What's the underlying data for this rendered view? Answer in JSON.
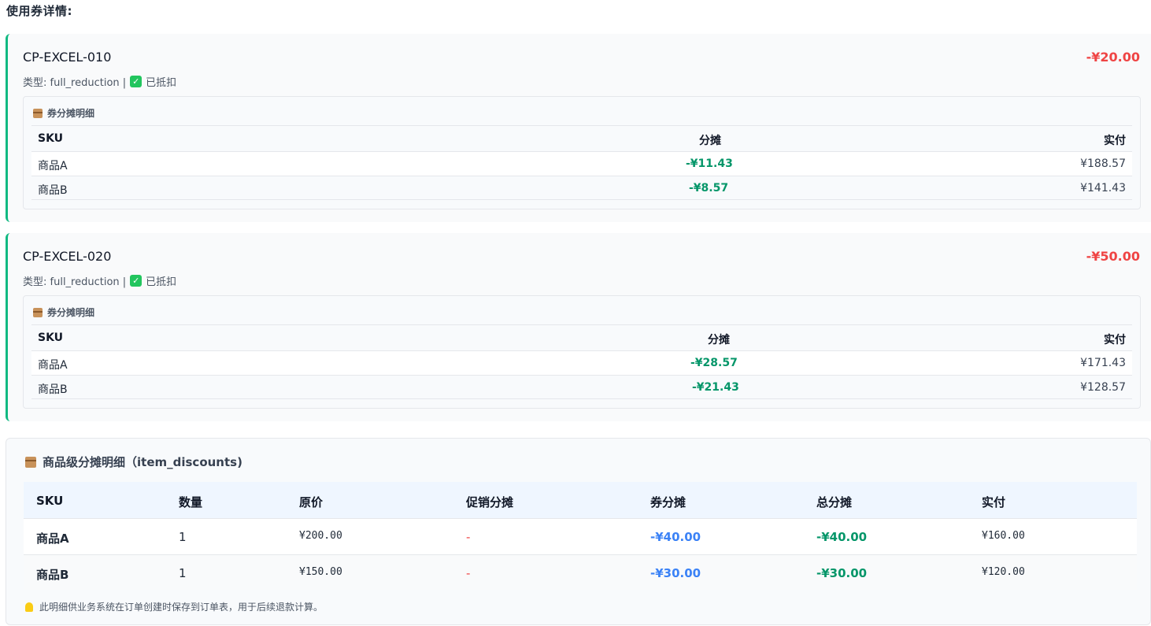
{
  "page_title": "使用券详情:",
  "coupons": [
    {
      "code": "CP-EXCEL-010",
      "amount": "-¥20.00",
      "meta_prefix": "类型: full_reduction |",
      "status": "已抵扣",
      "alloc_title": "券分摊明细",
      "headers": {
        "sku": "SKU",
        "alloc": "分摊",
        "paid": "实付"
      },
      "rows": [
        {
          "sku": "商品A",
          "alloc": "-¥11.43",
          "paid": "¥188.57"
        },
        {
          "sku": "商品B",
          "alloc": "-¥8.57",
          "paid": "¥141.43"
        }
      ]
    },
    {
      "code": "CP-EXCEL-020",
      "amount": "-¥50.00",
      "meta_prefix": "类型: full_reduction |",
      "status": "已抵扣",
      "alloc_title": "券分摊明细",
      "headers": {
        "sku": "SKU",
        "alloc": "分摊",
        "paid": "实付"
      },
      "rows": [
        {
          "sku": "商品A",
          "alloc": "-¥28.57",
          "paid": "¥171.43"
        },
        {
          "sku": "商品B",
          "alloc": "-¥21.43",
          "paid": "¥128.57"
        }
      ]
    }
  ],
  "items_section": {
    "title": "商品级分摊明细（item_discounts)",
    "headers": {
      "sku": "SKU",
      "qty": "数量",
      "orig": "原价",
      "promo": "促销分摊",
      "coupon": "券分摊",
      "total": "总分摊",
      "paid": "实付"
    },
    "rows": [
      {
        "sku": "商品A",
        "qty": "1",
        "orig": "¥200.00",
        "promo": "-",
        "coupon": "-¥40.00",
        "total": "-¥40.00",
        "paid": "¥160.00"
      },
      {
        "sku": "商品B",
        "qty": "1",
        "orig": "¥150.00",
        "promo": "-",
        "coupon": "-¥30.00",
        "total": "-¥30.00",
        "paid": "¥120.00"
      }
    ],
    "note": "此明细供业务系统在订单创建时保存到订单表，用于后续退款计算。"
  },
  "colors": {
    "accent_green": "#10b981",
    "amount_red": "#ef4444",
    "coupon_blue": "#3b82f6",
    "alloc_green": "#059669"
  }
}
